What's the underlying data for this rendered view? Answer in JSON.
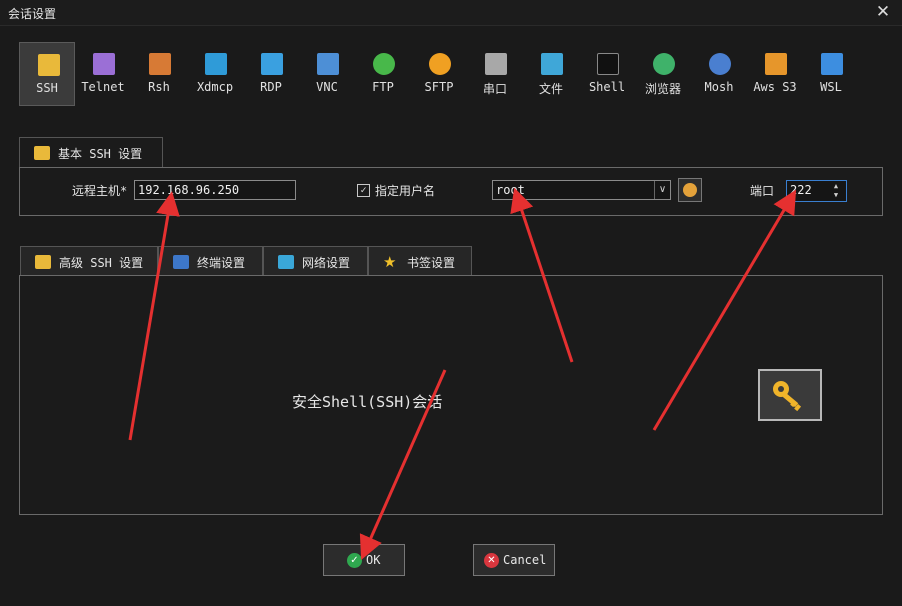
{
  "window": {
    "title": "会话设置",
    "close_glyph": "✕"
  },
  "session_types": [
    {
      "label": "SSH",
      "icon": "ssh-key-icon",
      "color": "#e9b93a"
    },
    {
      "label": "Telnet",
      "icon": "telnet-icon",
      "color": "#9b6fd6"
    },
    {
      "label": "Rsh",
      "icon": "rsh-icon",
      "color": "#d77a35"
    },
    {
      "label": "Xdmcp",
      "icon": "xdmcp-icon",
      "color": "#2f9bd8"
    },
    {
      "label": "RDP",
      "icon": "rdp-icon",
      "color": "#3aa0e0"
    },
    {
      "label": "VNC",
      "icon": "vnc-icon",
      "color": "#4d8fd6"
    },
    {
      "label": "FTP",
      "icon": "ftp-icon",
      "color": "#48b84a"
    },
    {
      "label": "SFTP",
      "icon": "sftp-icon",
      "color": "#f0a022"
    },
    {
      "label": "串口",
      "icon": "serial-icon",
      "color": "#a8a8a8"
    },
    {
      "label": "文件",
      "icon": "file-icon",
      "color": "#3fa7d8"
    },
    {
      "label": "Shell",
      "icon": "shell-icon",
      "color": "#555555"
    },
    {
      "label": "浏览器",
      "icon": "browser-icon",
      "color": "#3fb26a"
    },
    {
      "label": "Mosh",
      "icon": "mosh-icon",
      "color": "#4a7fd0"
    },
    {
      "label": "Aws S3",
      "icon": "aws-s3-icon",
      "color": "#e6962b"
    },
    {
      "label": "WSL",
      "icon": "wsl-icon",
      "color": "#3d8ee0"
    }
  ],
  "basic_tab": {
    "label": "基本 SSH 设置",
    "icon": "wrench-icon"
  },
  "basic": {
    "remote_host_label": "远程主机*",
    "remote_host_value": "192.168.96.250",
    "specify_username_label": "指定用户名",
    "specify_username_checked": true,
    "username_value": "root",
    "port_label": "端口",
    "port_value": "222"
  },
  "advanced_tabs": [
    {
      "label": "高级 SSH 设置",
      "icon": "wrench-icon"
    },
    {
      "label": "终端设置",
      "icon": "terminal-icon"
    },
    {
      "label": "网络设置",
      "icon": "network-icon"
    },
    {
      "label": "书签设置",
      "icon": "star-icon"
    }
  ],
  "content": {
    "description": "安全Shell(SSH)会话",
    "badge_icon": "key-icon"
  },
  "buttons": {
    "ok_label": "OK",
    "cancel_label": "Cancel"
  },
  "colors": {
    "accent": "#e53030",
    "ok_icon": "#2fa84f",
    "cancel_icon": "#d9363e",
    "key": "#f0b42a"
  }
}
